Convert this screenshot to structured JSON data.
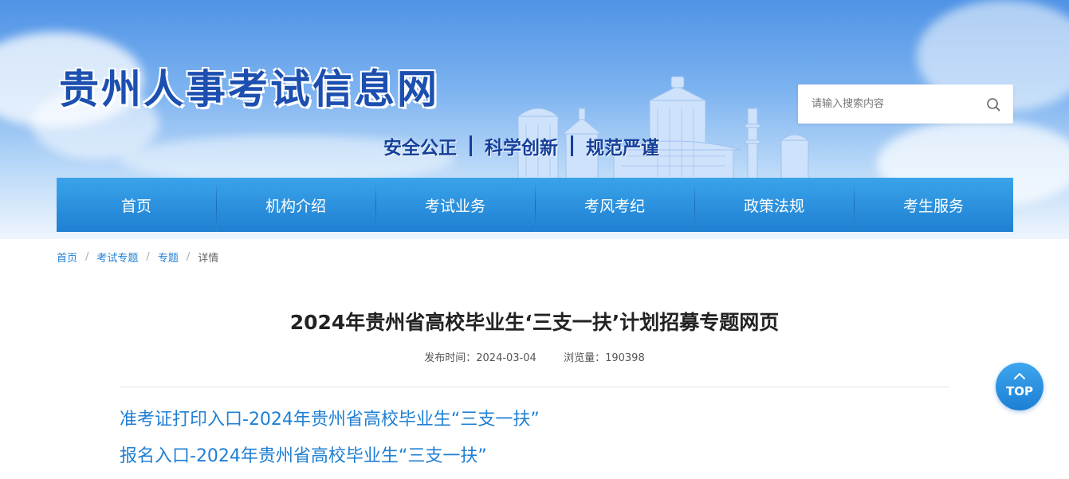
{
  "header": {
    "site_title": "贵州人事考试信息网",
    "slogan": [
      "安全公正",
      "科学创新",
      "规范严谨"
    ],
    "search": {
      "placeholder": "请输入搜索内容",
      "icon": "search-icon"
    }
  },
  "nav": {
    "items": [
      {
        "label": "首页"
      },
      {
        "label": "机构介绍"
      },
      {
        "label": "考试业务"
      },
      {
        "label": "考风考纪"
      },
      {
        "label": "政策法规"
      },
      {
        "label": "考生服务"
      }
    ]
  },
  "breadcrumb": {
    "items": [
      "首页",
      "考试专题",
      "专题"
    ],
    "current": "详情",
    "separator": "/"
  },
  "article": {
    "title": "2024年贵州省高校毕业生‘三支一扶’计划招募专题网页",
    "publish_label": "发布时间：2024-03-04",
    "views_label": "浏览量：190398",
    "links": [
      "准考证打印入口-2024年贵州省高校毕业生“三支一扶”",
      "报名入口-2024年贵州省高校毕业生“三支一扶”"
    ]
  },
  "top_button": {
    "label": "TOP",
    "icon": "chevron-up-icon"
  },
  "colors": {
    "brand_blue": "#1f7fd3",
    "nav_gradient_top": "#3aa3ea",
    "nav_gradient_bottom": "#1f80d2",
    "title_blue": "#1c4fb0"
  }
}
